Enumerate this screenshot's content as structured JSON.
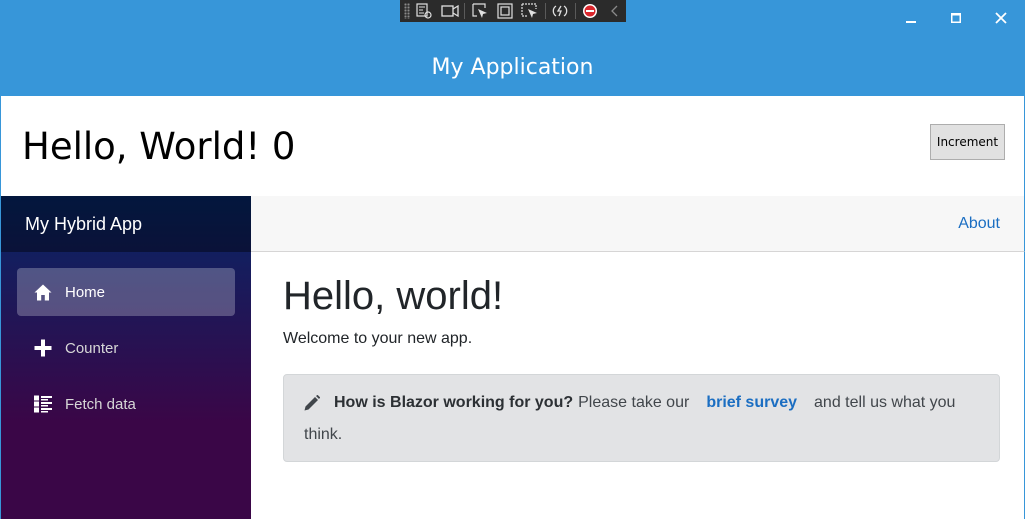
{
  "window": {
    "title": "My Application",
    "controls": {
      "minimize_icon": "minimize-icon",
      "maximize_icon": "maximize-icon",
      "close_icon": "close-icon"
    }
  },
  "debug_toolbar": {
    "buttons": [
      "live-visual-tree-icon",
      "record-icon",
      "select-element-icon",
      "display-layout-adorners-icon",
      "track-focused-element-icon",
      "hot-reload-icon",
      "stop-icon",
      "collapse-icon"
    ]
  },
  "header": {
    "counter_text": "Hello, World! 0",
    "increment_label": "Increment"
  },
  "sidebar": {
    "brand": "My Hybrid App",
    "items": [
      {
        "label": "Home",
        "icon": "home-icon",
        "active": true
      },
      {
        "label": "Counter",
        "icon": "plus-icon",
        "active": false
      },
      {
        "label": "Fetch data",
        "icon": "list-rich-icon",
        "active": false
      }
    ]
  },
  "top_row": {
    "about_label": "About"
  },
  "main": {
    "heading": "Hello, world!",
    "welcome": "Welcome to your new app.",
    "survey": {
      "icon": "pencil-icon",
      "question": "How is Blazor working for you?",
      "text_before": "Please take our",
      "link_label": "brief survey",
      "text_after": "and tell us what you",
      "text_wrap": "think."
    }
  },
  "colors": {
    "titlebar": "#3796d9",
    "sidebar_top": "#052767",
    "sidebar_bottom": "#3a0647",
    "link": "#1b6ec2",
    "alert_bg": "#e2e3e5"
  }
}
